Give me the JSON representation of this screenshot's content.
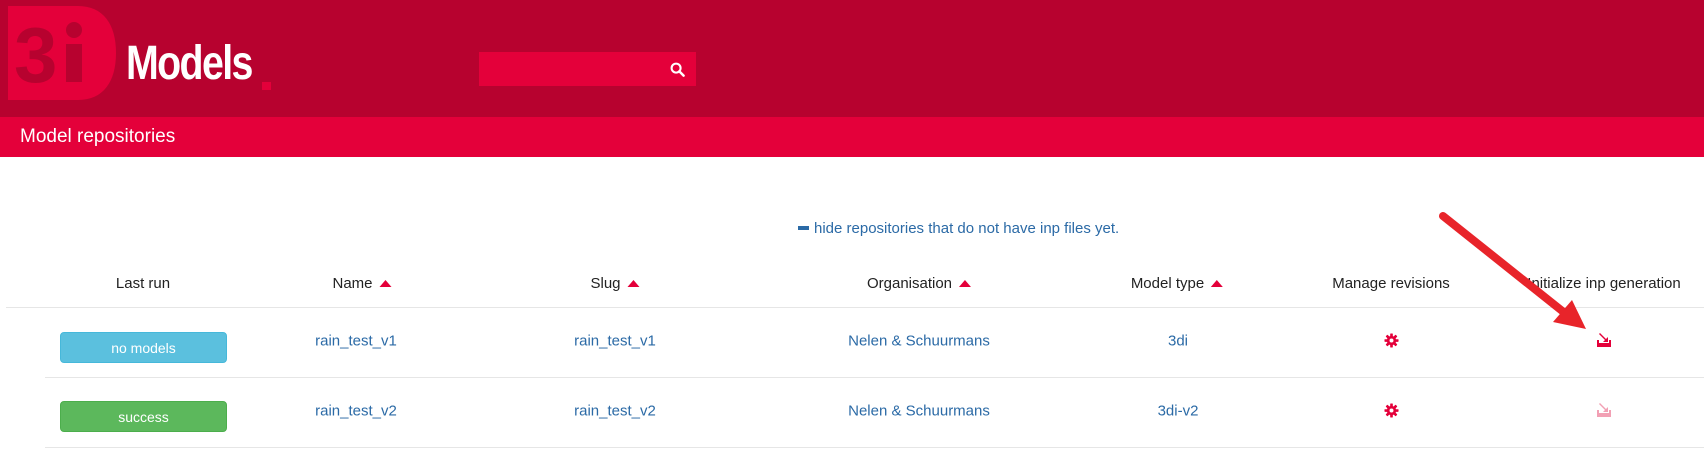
{
  "brand": {
    "logo_text": "Models",
    "logo_badge": "3di"
  },
  "header": {
    "search_placeholder": ""
  },
  "subheader": {
    "title": "Model repositories"
  },
  "filter": {
    "label": "hide repositories that do not have inp files yet."
  },
  "table": {
    "columns": [
      {
        "label": "Last run",
        "sortable": false
      },
      {
        "label": "Name",
        "sortable": true
      },
      {
        "label": "Slug",
        "sortable": true
      },
      {
        "label": "Organisation",
        "sortable": true
      },
      {
        "label": "Model type",
        "sortable": true
      },
      {
        "label": "Manage revisions",
        "sortable": false
      },
      {
        "label": "Initialize inp generation",
        "sortable": false
      }
    ],
    "rows": [
      {
        "last_run": "no models",
        "status_color": "#5bc0de",
        "name": "rain_test_v1",
        "slug": "rain_test_v1",
        "organisation": "Nelen & Schuurmans",
        "model_type": "3di",
        "inp_enabled": true
      },
      {
        "last_run": "success",
        "status_color": "#5cb85c",
        "name": "rain_test_v2",
        "slug": "rain_test_v2",
        "organisation": "Nelen & Schuurmans",
        "model_type": "3di-v2",
        "inp_enabled": false
      }
    ]
  },
  "colors": {
    "header_bg": "#b7022f",
    "accent": "#e4003a",
    "link": "#2b6aa6"
  },
  "icons": {
    "search": "search-icon",
    "settings": "gear-icon",
    "inp": "import-icon",
    "annotation": "arrow-annotation"
  }
}
